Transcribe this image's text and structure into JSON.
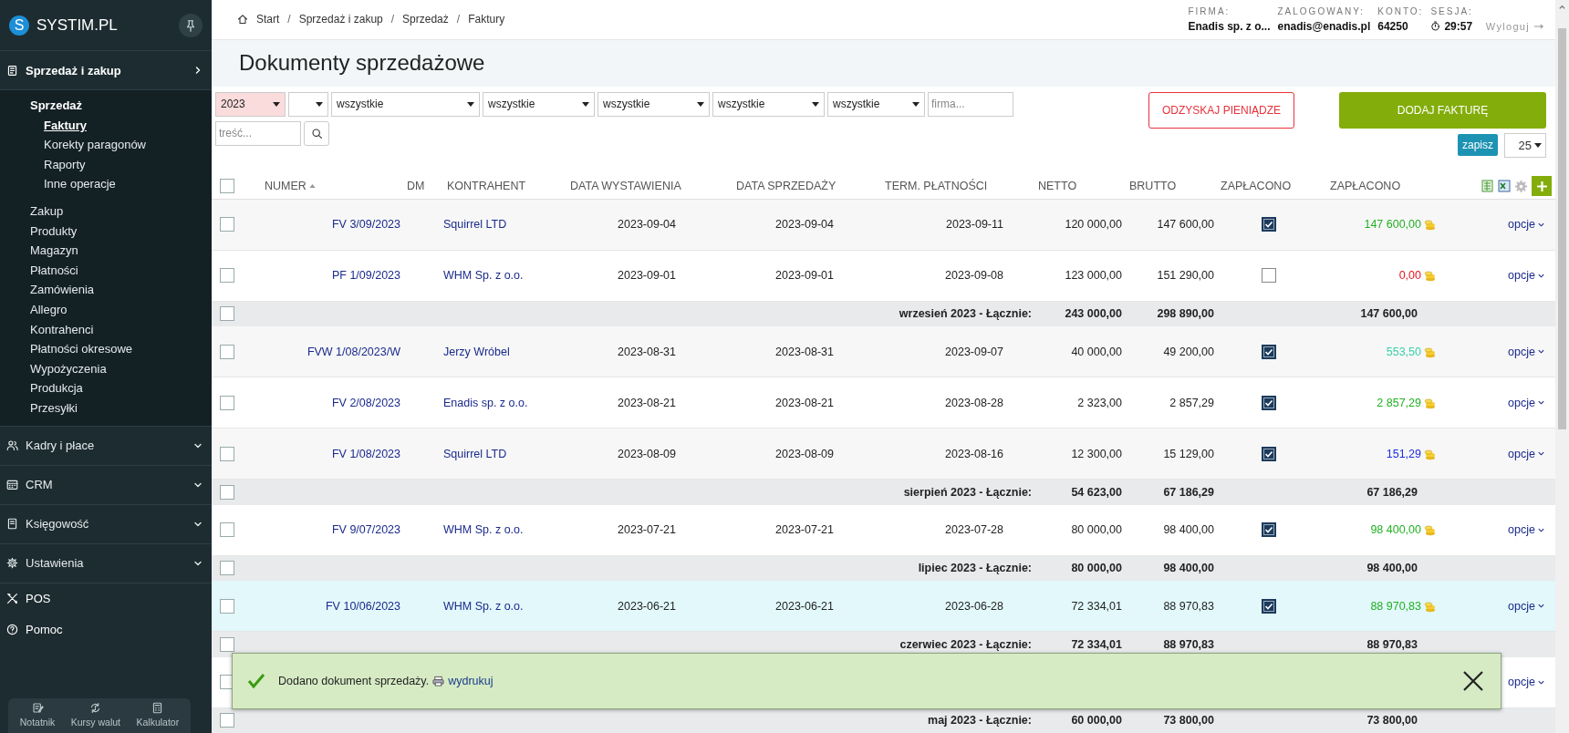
{
  "sidebar": {
    "logo_letter": "S",
    "logo": "SYSTIM.PL",
    "sections": [
      {
        "label": "Sprzedaż i zakup",
        "kind": "group",
        "expanded": true,
        "children": [
          {
            "label": "Sprzedaż",
            "selected": false,
            "children": [
              {
                "label": "Faktury",
                "selected": true
              },
              {
                "label": "Korekty paragonów",
                "selected": false
              },
              {
                "label": "Raporty",
                "selected": false
              },
              {
                "label": "Inne operacje",
                "selected": false
              }
            ]
          },
          {
            "label": "Zakup",
            "selected": false
          },
          {
            "label": "Produkty",
            "selected": false
          },
          {
            "label": "Magazyn",
            "selected": false
          },
          {
            "label": "Płatności",
            "selected": false
          },
          {
            "label": "Zamówienia",
            "selected": false
          },
          {
            "label": "Allegro",
            "selected": false
          },
          {
            "label": "Kontrahenci",
            "selected": false
          },
          {
            "label": "Płatności okresowe",
            "selected": false
          },
          {
            "label": "Wypożyczenia",
            "selected": false
          },
          {
            "label": "Produkcja",
            "selected": false
          },
          {
            "label": "Przesyłki",
            "selected": false
          }
        ]
      },
      {
        "label": "Kadry i płace",
        "kind": "group",
        "expanded": false
      },
      {
        "label": "CRM",
        "kind": "group",
        "expanded": false
      },
      {
        "label": "Księgowość",
        "kind": "group",
        "expanded": false
      },
      {
        "label": "Ustawienia",
        "kind": "group",
        "expanded": false
      },
      {
        "label": "POS",
        "kind": "link"
      },
      {
        "label": "Pomoc",
        "kind": "link"
      }
    ],
    "tools": [
      {
        "label": "Notatnik"
      },
      {
        "label": "Kursy walut"
      },
      {
        "label": "Kalkulator"
      }
    ]
  },
  "header": {
    "breadcrumbs": [
      "Start",
      "Sprzedaż i zakup",
      "Sprzedaż",
      "Faktury"
    ],
    "separator": "/",
    "info": [
      {
        "label": "FIRMA:",
        "value": "Enadis sp. z o..."
      },
      {
        "label": "ZALOGOWANY:",
        "value": "enadis@enadis.pl"
      },
      {
        "label": "KONTO:",
        "value": "64250"
      },
      {
        "label": "SESJA:",
        "value": "29:57",
        "kind": "timer"
      }
    ],
    "logout": "Wyloguj"
  },
  "title": "Dokumenty sprzedażowe",
  "filters": {
    "selects": [
      {
        "value": "2023",
        "highlighted": true
      },
      {
        "highlighted": false
      },
      {
        "value": "wszystkie",
        "highlighted": false
      },
      {
        "value": "wszystkie",
        "highlighted": false
      },
      {
        "value": "wszystkie",
        "highlighted": false
      },
      {
        "value": "wszystkie",
        "highlighted": false
      },
      {
        "value": "wszystkie",
        "highlighted": false
      }
    ],
    "company": {
      "placeholder": "firma..."
    },
    "content": {
      "placeholder": "treść..."
    }
  },
  "actions": {
    "recover": "ODZYSKAJ PIENIĄDZE",
    "add": "DODAJ FAKTURĘ",
    "save": "zapisz",
    "per_page": "25"
  },
  "table": {
    "columns": [
      "NUMER",
      "DM",
      "KONTRAHENT",
      "DATA WYSTAWIENIA",
      "DATA SPRZEDAŻY",
      "TERM. PŁATNOŚCI",
      "NETTO",
      "BRUTTO",
      "ZAPŁACONO",
      "ZAPŁACONO"
    ],
    "header_checked": false,
    "rows": [
      {
        "kind": "invoice",
        "checked": false,
        "highlighted": false,
        "number": "FV 3/09/2023",
        "contractor": "Squirrel LTD",
        "issued": "2023-09-04",
        "sold": "2023-09-04",
        "due": "2023-09-11",
        "net": "120 000,00",
        "gross": "147 600,00",
        "paid": true,
        "paid_amount": "147 600,00",
        "color": "#22b022",
        "action": "opcje"
      },
      {
        "kind": "invoice",
        "checked": false,
        "highlighted": false,
        "number": "PF 1/09/2023",
        "contractor": "WHM Sp. z o.o.",
        "issued": "2023-09-01",
        "sold": "2023-09-01",
        "due": "2023-09-08",
        "net": "123 000,00",
        "gross": "151 290,00",
        "paid": false,
        "paid_amount": "0,00",
        "color": "#e8141c",
        "action": "opcje"
      },
      {
        "kind": "summary",
        "checked": false,
        "label": "wrzesień 2023 - Łącznie:",
        "net": "243 000,00",
        "gross": "298 890,00",
        "paid_amount": "147 600,00"
      },
      {
        "kind": "invoice",
        "checked": false,
        "highlighted": false,
        "number": "FVW 1/08/2023/W",
        "contractor": "Jerzy Wróbel",
        "issued": "2023-08-31",
        "sold": "2023-08-31",
        "due": "2023-09-07",
        "net": "40 000,00",
        "gross": "49 200,00",
        "paid": true,
        "paid_amount": "553,50",
        "color": "#3ad0a8",
        "action": "opcje"
      },
      {
        "kind": "invoice",
        "checked": false,
        "highlighted": false,
        "number": "FV 2/08/2023",
        "contractor": "Enadis sp. z o.o.",
        "issued": "2023-08-21",
        "sold": "2023-08-21",
        "due": "2023-08-28",
        "net": "2 323,00",
        "gross": "2 857,29",
        "paid": true,
        "paid_amount": "2 857,29",
        "color": "#22b022",
        "action": "opcje"
      },
      {
        "kind": "invoice",
        "checked": false,
        "highlighted": false,
        "number": "FV 1/08/2023",
        "contractor": "Squirrel LTD",
        "issued": "2023-08-09",
        "sold": "2023-08-09",
        "due": "2023-08-16",
        "net": "12 300,00",
        "gross": "15 129,00",
        "paid": true,
        "paid_amount": "151,29",
        "color": "#1e2ee0",
        "action": "opcje"
      },
      {
        "kind": "summary",
        "checked": false,
        "label": "sierpień 2023 - Łącznie:",
        "net": "54 623,00",
        "gross": "67 186,29",
        "paid_amount": "67 186,29"
      },
      {
        "kind": "invoice",
        "checked": false,
        "highlighted": false,
        "number": "FV 9/07/2023",
        "contractor": "WHM Sp. z o.o.",
        "issued": "2023-07-21",
        "sold": "2023-07-21",
        "due": "2023-07-28",
        "net": "80 000,00",
        "gross": "98 400,00",
        "paid": true,
        "paid_amount": "98 400,00",
        "color": "#22b022",
        "action": "opcje"
      },
      {
        "kind": "summary",
        "checked": false,
        "label": "lipiec 2023 - Łącznie:",
        "net": "80 000,00",
        "gross": "98 400,00",
        "paid_amount": "98 400,00"
      },
      {
        "kind": "invoice",
        "checked": false,
        "highlighted": true,
        "number": "FV 10/06/2023",
        "contractor": "WHM Sp. z o.o.",
        "issued": "2023-06-21",
        "sold": "2023-06-21",
        "due": "2023-06-28",
        "net": "72 334,01",
        "gross": "88 970,83",
        "paid": true,
        "paid_amount": "88 970,83",
        "color": "#22b022",
        "action": "opcje"
      },
      {
        "kind": "summary",
        "checked": false,
        "label": "czerwiec 2023 - Łącznie:",
        "net": "72 334,01",
        "gross": "88 970,83",
        "paid_amount": "88 970,83"
      },
      {
        "kind": "invoice",
        "checked": false,
        "highlighted": false,
        "action": "opcje"
      },
      {
        "kind": "summary",
        "checked": false,
        "label": "maj 2023 - Łącznie:",
        "net": "60 000,00",
        "gross": "73 800,00",
        "paid_amount": "73 800,00"
      }
    ]
  },
  "toast": {
    "message": "Dodano dokument sprzedaży.",
    "link": "wydrukuj"
  }
}
